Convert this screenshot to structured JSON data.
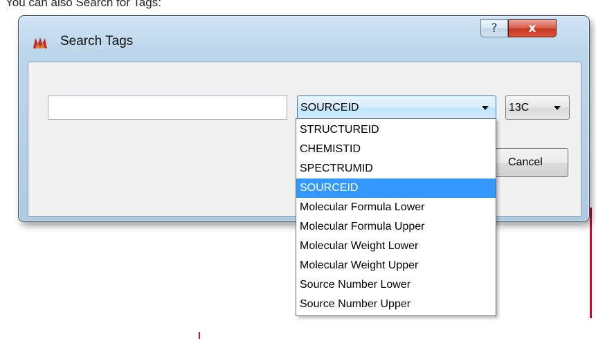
{
  "caption": "You can also Search for Tags:",
  "window": {
    "title": "Search Tags",
    "help_label": "?",
    "close_label": "x"
  },
  "search": {
    "value": "",
    "placeholder": ""
  },
  "field_combo": {
    "selected": "SOURCEID"
  },
  "nucleus_combo": {
    "selected": "13C"
  },
  "buttons": {
    "cancel_label": "Cancel"
  },
  "dropdown": {
    "items": [
      "STRUCTUREID",
      "CHEMISTID",
      "SPECTRUMID",
      "SOURCEID",
      "Molecular Formula Lower",
      "Molecular Formula Upper",
      "Molecular Weight Lower",
      "Molecular Weight Upper",
      "Source Number Lower",
      "Source Number Upper"
    ],
    "selected_index": 3
  },
  "colors": {
    "selection": "#3399ff",
    "close_button": "#c4381f",
    "trace": "#c8102e"
  },
  "icons": {
    "app": "mnova-logo-icon",
    "arrow": "chevron-down-icon"
  }
}
